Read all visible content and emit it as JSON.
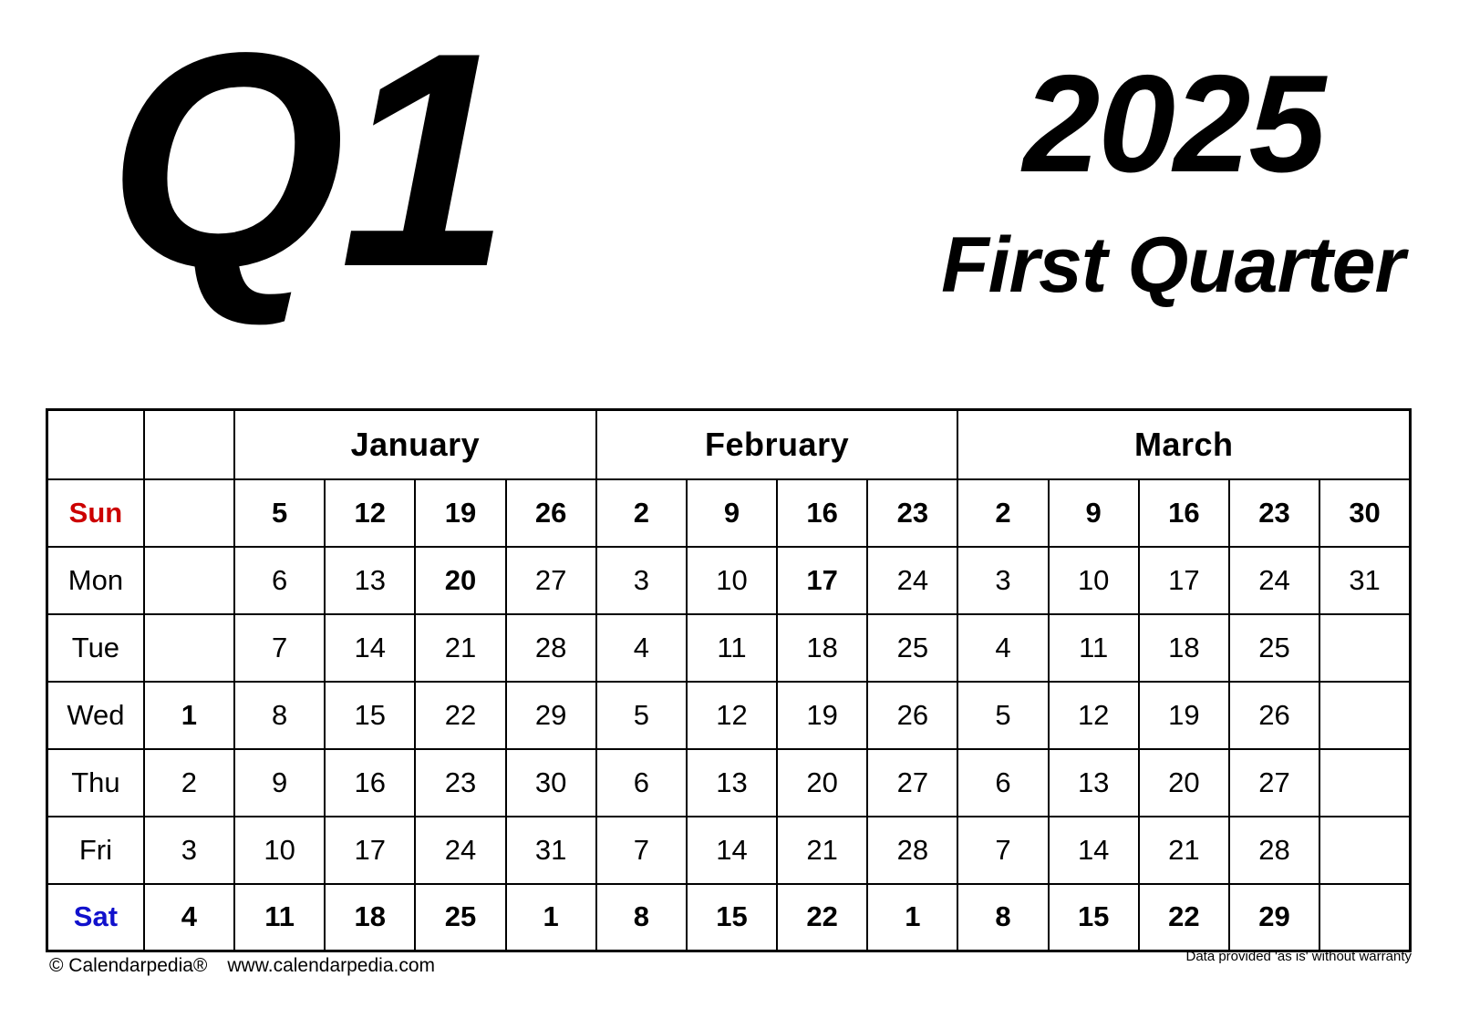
{
  "header": {
    "quarter_label": "Q1",
    "year": "2025",
    "subtitle": "First Quarter"
  },
  "footer": {
    "copyright": "© Calendarpedia®",
    "website": "www.calendarpedia.com",
    "disclaimer": "Data provided 'as is' without warranty"
  },
  "colors": {
    "sunday_red": "#CC0000",
    "saturday_blue": "#1111CC",
    "shaded_cell": "#e4e4e4",
    "plain_cell": "#ffffff",
    "grid_line": "#000000",
    "text": "#000000"
  },
  "calendar": {
    "months": [
      {
        "name": "January",
        "span": 4,
        "shaded": true
      },
      {
        "name": "February",
        "span": 4,
        "shaded": false
      },
      {
        "name": "March",
        "span": 5,
        "shaded": true
      }
    ],
    "weekday_labels": [
      "Sun",
      "Mon",
      "Tue",
      "Wed",
      "Thu",
      "Fri",
      "Sat"
    ],
    "rows": [
      {
        "day": "Sun",
        "kind": "sun",
        "cells": [
          {
            "v": "",
            "bg": "plain",
            "style": "empty"
          },
          {
            "v": "5",
            "bg": "shade",
            "style": "sun"
          },
          {
            "v": "12",
            "bg": "shade",
            "style": "sun"
          },
          {
            "v": "19",
            "bg": "shade",
            "style": "sun"
          },
          {
            "v": "26",
            "bg": "shade",
            "style": "sun"
          },
          {
            "v": "2",
            "bg": "plain",
            "style": "sun"
          },
          {
            "v": "9",
            "bg": "plain",
            "style": "sun"
          },
          {
            "v": "16",
            "bg": "plain",
            "style": "sun"
          },
          {
            "v": "23",
            "bg": "plain",
            "style": "sun"
          },
          {
            "v": "2",
            "bg": "shade",
            "style": "sun"
          },
          {
            "v": "9",
            "bg": "shade",
            "style": "sun"
          },
          {
            "v": "16",
            "bg": "shade",
            "style": "sun"
          },
          {
            "v": "23",
            "bg": "shade",
            "style": "sun"
          },
          {
            "v": "30",
            "bg": "shade",
            "style": "sun"
          }
        ]
      },
      {
        "day": "Mon",
        "kind": "weekday",
        "cells": [
          {
            "v": "",
            "bg": "plain",
            "style": "empty"
          },
          {
            "v": "6",
            "bg": "shade",
            "style": "normal"
          },
          {
            "v": "13",
            "bg": "shade",
            "style": "normal"
          },
          {
            "v": "20",
            "bg": "shade",
            "style": "holiday"
          },
          {
            "v": "27",
            "bg": "shade",
            "style": "normal"
          },
          {
            "v": "3",
            "bg": "plain",
            "style": "normal"
          },
          {
            "v": "10",
            "bg": "plain",
            "style": "normal"
          },
          {
            "v": "17",
            "bg": "plain",
            "style": "holiday"
          },
          {
            "v": "24",
            "bg": "plain",
            "style": "normal"
          },
          {
            "v": "3",
            "bg": "shade",
            "style": "normal"
          },
          {
            "v": "10",
            "bg": "shade",
            "style": "normal"
          },
          {
            "v": "17",
            "bg": "shade",
            "style": "normal"
          },
          {
            "v": "24",
            "bg": "shade",
            "style": "normal"
          },
          {
            "v": "31",
            "bg": "shade",
            "style": "normal"
          }
        ]
      },
      {
        "day": "Tue",
        "kind": "weekday",
        "cells": [
          {
            "v": "",
            "bg": "plain",
            "style": "empty"
          },
          {
            "v": "7",
            "bg": "shade",
            "style": "normal"
          },
          {
            "v": "14",
            "bg": "shade",
            "style": "normal"
          },
          {
            "v": "21",
            "bg": "shade",
            "style": "normal"
          },
          {
            "v": "28",
            "bg": "shade",
            "style": "normal"
          },
          {
            "v": "4",
            "bg": "plain",
            "style": "normal"
          },
          {
            "v": "11",
            "bg": "plain",
            "style": "normal"
          },
          {
            "v": "18",
            "bg": "plain",
            "style": "normal"
          },
          {
            "v": "25",
            "bg": "plain",
            "style": "normal"
          },
          {
            "v": "4",
            "bg": "shade",
            "style": "normal"
          },
          {
            "v": "11",
            "bg": "shade",
            "style": "normal"
          },
          {
            "v": "18",
            "bg": "shade",
            "style": "normal"
          },
          {
            "v": "25",
            "bg": "shade",
            "style": "normal"
          },
          {
            "v": "",
            "bg": "plain",
            "style": "empty"
          }
        ]
      },
      {
        "day": "Wed",
        "kind": "weekday",
        "cells": [
          {
            "v": "1",
            "bg": "shade",
            "style": "holiday"
          },
          {
            "v": "8",
            "bg": "shade",
            "style": "normal"
          },
          {
            "v": "15",
            "bg": "shade",
            "style": "normal"
          },
          {
            "v": "22",
            "bg": "shade",
            "style": "normal"
          },
          {
            "v": "29",
            "bg": "shade",
            "style": "normal"
          },
          {
            "v": "5",
            "bg": "plain",
            "style": "normal"
          },
          {
            "v": "12",
            "bg": "plain",
            "style": "normal"
          },
          {
            "v": "19",
            "bg": "plain",
            "style": "normal"
          },
          {
            "v": "26",
            "bg": "plain",
            "style": "normal"
          },
          {
            "v": "5",
            "bg": "shade",
            "style": "normal"
          },
          {
            "v": "12",
            "bg": "shade",
            "style": "normal"
          },
          {
            "v": "19",
            "bg": "shade",
            "style": "normal"
          },
          {
            "v": "26",
            "bg": "shade",
            "style": "normal"
          },
          {
            "v": "",
            "bg": "plain",
            "style": "empty"
          }
        ]
      },
      {
        "day": "Thu",
        "kind": "weekday",
        "cells": [
          {
            "v": "2",
            "bg": "shade",
            "style": "normal"
          },
          {
            "v": "9",
            "bg": "shade",
            "style": "normal"
          },
          {
            "v": "16",
            "bg": "shade",
            "style": "normal"
          },
          {
            "v": "23",
            "bg": "shade",
            "style": "normal"
          },
          {
            "v": "30",
            "bg": "shade",
            "style": "normal"
          },
          {
            "v": "6",
            "bg": "plain",
            "style": "normal"
          },
          {
            "v": "13",
            "bg": "plain",
            "style": "normal"
          },
          {
            "v": "20",
            "bg": "plain",
            "style": "normal"
          },
          {
            "v": "27",
            "bg": "plain",
            "style": "normal"
          },
          {
            "v": "6",
            "bg": "shade",
            "style": "normal"
          },
          {
            "v": "13",
            "bg": "shade",
            "style": "normal"
          },
          {
            "v": "20",
            "bg": "shade",
            "style": "normal"
          },
          {
            "v": "27",
            "bg": "shade",
            "style": "normal"
          },
          {
            "v": "",
            "bg": "plain",
            "style": "empty"
          }
        ]
      },
      {
        "day": "Fri",
        "kind": "weekday",
        "cells": [
          {
            "v": "3",
            "bg": "shade",
            "style": "normal"
          },
          {
            "v": "10",
            "bg": "shade",
            "style": "normal"
          },
          {
            "v": "17",
            "bg": "shade",
            "style": "normal"
          },
          {
            "v": "24",
            "bg": "shade",
            "style": "normal"
          },
          {
            "v": "31",
            "bg": "shade",
            "style": "normal"
          },
          {
            "v": "7",
            "bg": "plain",
            "style": "normal"
          },
          {
            "v": "14",
            "bg": "plain",
            "style": "normal"
          },
          {
            "v": "21",
            "bg": "plain",
            "style": "normal"
          },
          {
            "v": "28",
            "bg": "plain",
            "style": "normal"
          },
          {
            "v": "7",
            "bg": "shade",
            "style": "normal"
          },
          {
            "v": "14",
            "bg": "shade",
            "style": "normal"
          },
          {
            "v": "21",
            "bg": "shade",
            "style": "normal"
          },
          {
            "v": "28",
            "bg": "shade",
            "style": "normal"
          },
          {
            "v": "",
            "bg": "plain",
            "style": "empty"
          }
        ]
      },
      {
        "day": "Sat",
        "kind": "sat",
        "cells": [
          {
            "v": "4",
            "bg": "shade",
            "style": "sat"
          },
          {
            "v": "11",
            "bg": "shade",
            "style": "sat"
          },
          {
            "v": "18",
            "bg": "shade",
            "style": "sat"
          },
          {
            "v": "25",
            "bg": "shade",
            "style": "sat"
          },
          {
            "v": "1",
            "bg": "plain",
            "style": "sat"
          },
          {
            "v": "8",
            "bg": "plain",
            "style": "sat"
          },
          {
            "v": "15",
            "bg": "plain",
            "style": "sat"
          },
          {
            "v": "22",
            "bg": "plain",
            "style": "sat"
          },
          {
            "v": "1",
            "bg": "shade",
            "style": "sat"
          },
          {
            "v": "8",
            "bg": "shade",
            "style": "sat"
          },
          {
            "v": "15",
            "bg": "shade",
            "style": "sat"
          },
          {
            "v": "22",
            "bg": "shade",
            "style": "sat"
          },
          {
            "v": "29",
            "bg": "shade",
            "style": "sat"
          },
          {
            "v": "",
            "bg": "plain",
            "style": "empty"
          }
        ]
      }
    ]
  }
}
